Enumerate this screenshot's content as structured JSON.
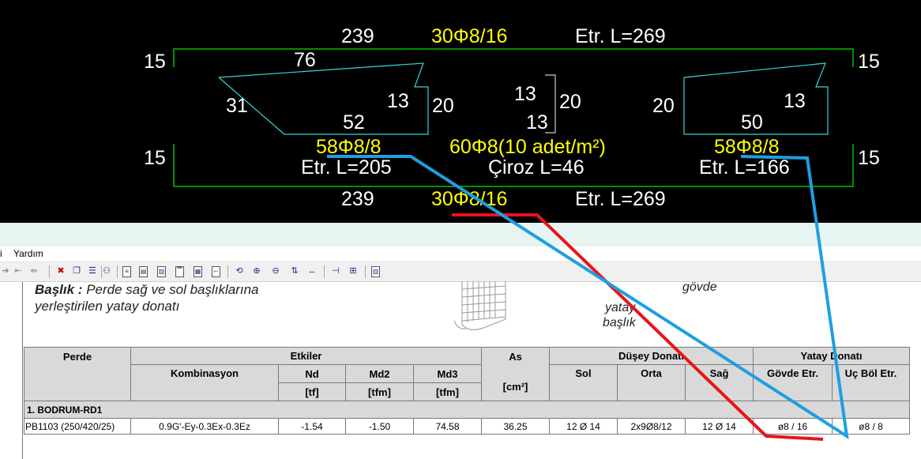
{
  "cad": {
    "top_count": "239",
    "top_rebar": "30Φ8/16",
    "top_length": "Etr. L=269",
    "bottom_count": "239",
    "bottom_rebar": "30Φ8/16",
    "bottom_length": "Etr. L=269",
    "left_top_15": "15",
    "left_bot_15": "15",
    "right_top_15": "15",
    "right_bot_15": "15",
    "left_shape": {
      "top": "76",
      "left": "31",
      "right": "13",
      "bottom": "52",
      "side": "20"
    },
    "mid_shape": {
      "top": "13",
      "bottom": "13",
      "side": "20"
    },
    "right_shape": {
      "side": "20",
      "right": "13",
      "bottom": "50"
    },
    "left_rebar": "58Φ8/8",
    "left_stirrup": "Etr. L=205",
    "mid_rebar": "60Φ8(10 adet/m²)",
    "mid_tie": "Çiroz L=46",
    "right_rebar": "58Φ8/8",
    "right_stirrup": "Etr. L=166",
    "colors": {
      "background": "#000000",
      "text": "#ffffff",
      "highlight": "#ffff00",
      "line": "#00cc00",
      "shape": "#35d7d7"
    }
  },
  "menu": {
    "item_i": "i",
    "help": "Yardım"
  },
  "toolbar": {
    "icons": [
      "arrow-right-icon",
      "first-page-icon",
      "prev-page-icon",
      "delete-icon",
      "copy-icon",
      "align-icon",
      "page-icon",
      "page-left-icon",
      "page-right-icon",
      "page-top-icon",
      "table-icon",
      "collapse-icon",
      "refresh-icon",
      "zoom-in-icon",
      "zoom-out-icon",
      "sort-icon",
      "fit-width-icon",
      "split-h-icon",
      "split-grid-icon",
      "columns-icon"
    ]
  },
  "doc": {
    "heading_bold": "Başlık :",
    "heading_rest": "Perde sağ ve sol başlıklarına",
    "heading_line2": "yerleştirilen yatay donatı",
    "sketch_labels": {
      "body": "gövde",
      "horizontal": "yatay",
      "head": "başlık"
    }
  },
  "table": {
    "headers": {
      "perde": "Perde",
      "etkiler": "Etkiler",
      "as": "As",
      "as_unit": "[cm²]",
      "dusey": "Düşey Donatı",
      "yatay": "Yatay Donatı",
      "kombinasyon": "Kombinasyon",
      "nd": "Nd",
      "nd_unit": "[tf]",
      "md2": "Md2",
      "md2_unit": "[tfm]",
      "md3": "Md3",
      "md3_unit": "[tfm]",
      "sol": "Sol",
      "orta": "Orta",
      "sag": "Sağ",
      "govde": "Gövde Etr.",
      "uc": "Uç Böl Etr."
    },
    "section": "1. BODRUM-RD1",
    "rows": [
      {
        "perde": "PB1103 (250/420/25)",
        "kombinasyon": "0.9G'-Ey-0.3Ex-0.3Ez",
        "nd": "-1.54",
        "md2": "-1.50",
        "md3": "74.58",
        "as": "36.25",
        "sol": "12 Ø 14",
        "orta": "2x9Ø8/12",
        "sag": "12 Ø 14",
        "govde": "ø8 / 16",
        "uc": "ø8 / 8"
      }
    ]
  },
  "annotations": {
    "red": "#e8141a",
    "blue": "#1e9fe0"
  }
}
